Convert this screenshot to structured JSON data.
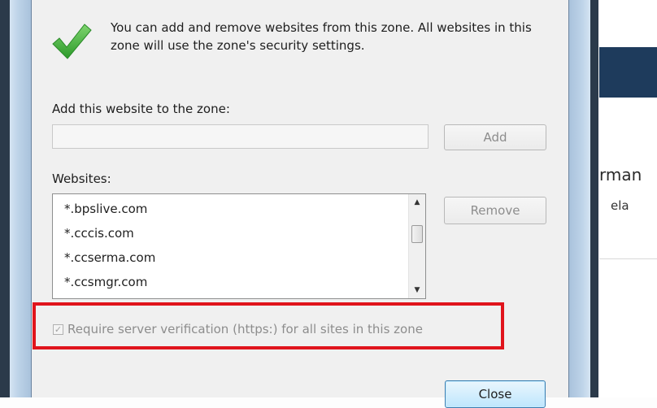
{
  "info": {
    "text": "You can add and remove websites from this zone. All websites in this zone will use the zone's security settings."
  },
  "add_section": {
    "label": "Add this website to the zone:",
    "input_value": "",
    "add_button": "Add"
  },
  "websites": {
    "label": "Websites:",
    "items": [
      "*.bpslive.com",
      "*.cccis.com",
      "*.ccserma.com",
      "*.ccsmgr.com"
    ],
    "remove_button": "Remove"
  },
  "require_https": {
    "label": "Require server verification (https:) for all sites in this zone",
    "checked": true
  },
  "footer": {
    "close_button": "Close"
  },
  "background_page": {
    "heading_fragment": "rman",
    "sub_fragment": "ela"
  },
  "colors": {
    "highlight": "#e0141c",
    "checkmark": "#3aa832"
  }
}
